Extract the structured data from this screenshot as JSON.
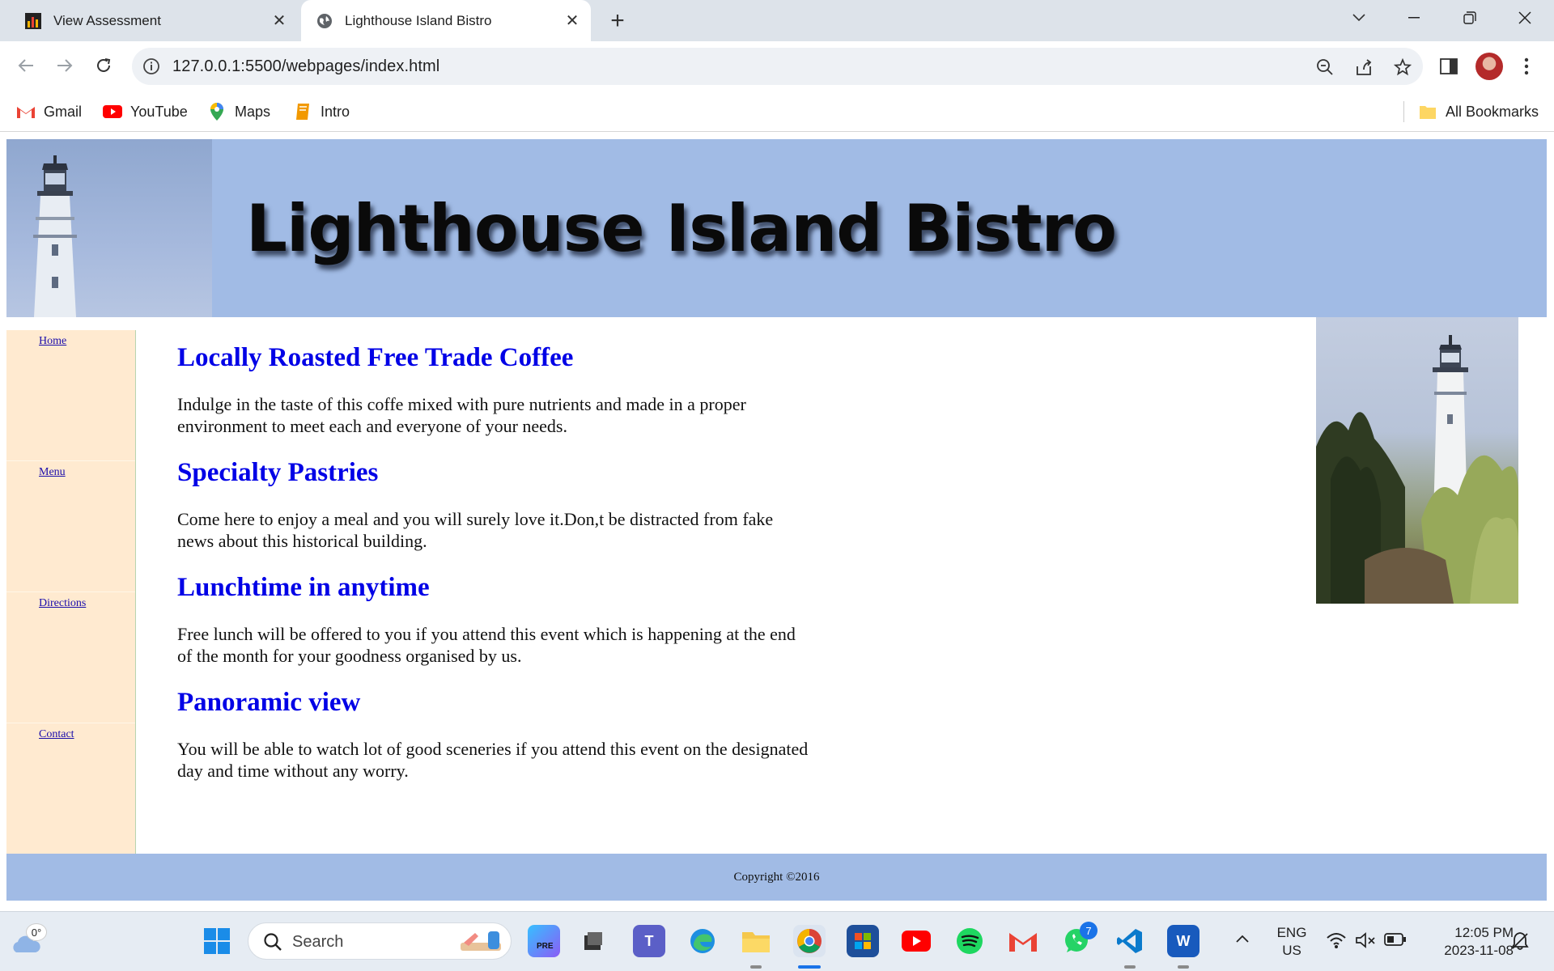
{
  "browser": {
    "tabs": [
      {
        "title": "View Assessment",
        "active": false
      },
      {
        "title": "Lighthouse Island Bistro",
        "active": true
      }
    ],
    "url": "127.0.0.1:5500/webpages/index.html",
    "bookmarks": [
      "Gmail",
      "YouTube",
      "Maps",
      "Intro"
    ],
    "all_bookmarks_label": "All Bookmarks"
  },
  "site": {
    "title": "Lighthouse Island Bistro",
    "nav": [
      {
        "label": "Home"
      },
      {
        "label": "Menu"
      },
      {
        "label": "Directions"
      },
      {
        "label": "Contact"
      }
    ],
    "sections": [
      {
        "heading": "Locally Roasted Free Trade Coffee",
        "body": "Indulge in the taste of this coffe mixed with pure nutrients and made in a proper environment to meet each and everyone of your needs."
      },
      {
        "heading": "Specialty Pastries",
        "body": "Come here to enjoy a meal and you will surely love it.Don,t be distracted from fake news about this historical building."
      },
      {
        "heading": "Lunchtime in anytime",
        "body": "Free lunch will be offered to you if you attend this event which is happening at the end of the month for your goodness organised by us."
      },
      {
        "heading": "Panoramic view",
        "body": "You will be able to watch lot of good sceneries if you attend this event on the designated day and time without any worry."
      }
    ],
    "footer": "Copyright ©2016"
  },
  "taskbar": {
    "weather": "0°",
    "search_placeholder": "Search",
    "whatsapp_badge": "7",
    "language": "ENG",
    "region": "US",
    "time": "12:05 PM",
    "date": "2023-11-08"
  },
  "colors": {
    "header_bg": "#a1bbe5",
    "nav_bg": "#ffead0",
    "heading": "#0000e6"
  }
}
